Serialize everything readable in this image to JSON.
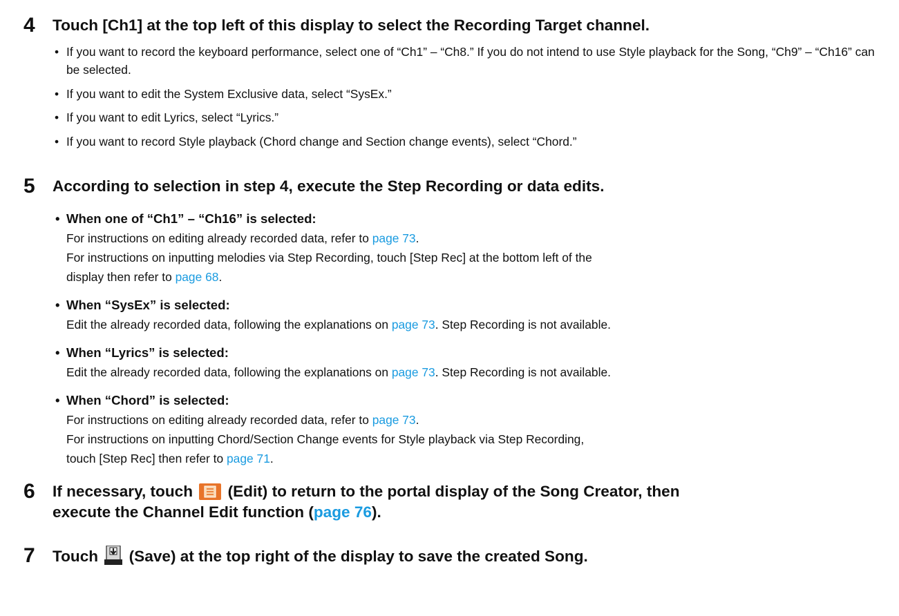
{
  "step4": {
    "number": "4",
    "title": "Touch [Ch1] at the top left of this display to select the Recording Target channel.",
    "bullets": [
      "If you want to record the keyboard performance, select one of “Ch1” – “Ch8.” If you do not intend to use Style playback for the Song, “Ch9” – “Ch16” can be selected.",
      "If you want to edit the System Exclusive data, select “SysEx.”",
      "If you want to edit Lyrics, select “Lyrics.”",
      "If you want to record Style playback (Chord change and Section change events), select “Chord.”"
    ]
  },
  "step5": {
    "number": "5",
    "title": "According to selection in step 4, execute the Step Recording or data edits.",
    "ch": {
      "heading": "When one of “Ch1” – “Ch16” is selected:",
      "line1_text": "For instructions on editing already recorded data, refer to ",
      "line1_link": "page 73",
      "line1_end": ".",
      "line2_text": "For instructions on inputting melodies via Step Recording, touch [Step Rec] at the bottom left of the",
      "line3_text": "display then refer to ",
      "line3_link": "page 68",
      "line3_end": "."
    },
    "sysex": {
      "heading": "When “SysEx” is selected:",
      "line1_text": "Edit the already recorded data, following the explanations on ",
      "line1_link": "page 73",
      "line1_end": ". Step Recording is not available."
    },
    "lyrics": {
      "heading": "When “Lyrics” is selected:",
      "line1_text": "Edit the already recorded data, following the explanations on ",
      "line1_link": "page 73",
      "line1_end": ". Step Recording is not available."
    },
    "chord": {
      "heading": "When “Chord” is selected:",
      "line1_text": "For instructions on editing already recorded data, refer to ",
      "line1_link": "page 73",
      "line1_end": ".",
      "line2_text": "For instructions on inputting Chord/Section Change events for Style playback via Step Recording,",
      "line3_text": "touch [Step Rec] then refer to ",
      "line3_link": "page 71",
      "line3_end": "."
    }
  },
  "step6": {
    "number": "6",
    "title_before": "If necessary, touch",
    "icon_name": "edit-list-icon",
    "title_after_line1": "(Edit) to return to the portal display of the Song Creator, then",
    "title_line2_before": "execute the Channel Edit function (",
    "title_link": "page 76",
    "title_line2_after": ")."
  },
  "step7": {
    "number": "7",
    "title_before": "Touch",
    "icon_name": "save-icon",
    "title_after": "(Save) at the top right of the display to save the created Song."
  },
  "colors": {
    "link": "#1a9be0",
    "edit_icon_bg": "#e8742a",
    "save_icon": "#222222"
  }
}
